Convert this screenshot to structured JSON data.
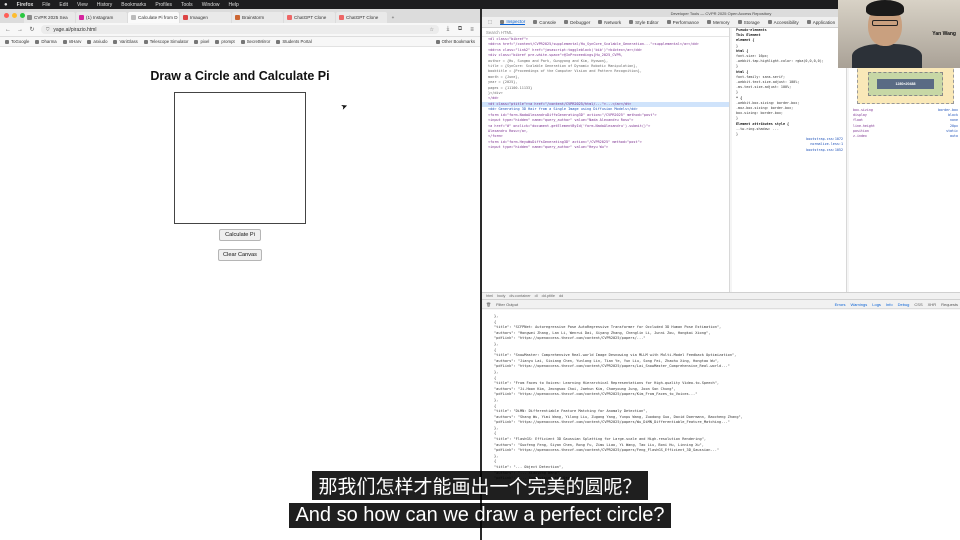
{
  "menubar": {
    "apple": "",
    "app": "Firefox",
    "items": [
      "File",
      "Edit",
      "View",
      "History",
      "Bookmarks",
      "Profiles",
      "Tools",
      "Window",
      "Help"
    ]
  },
  "browser": {
    "tabs": [
      {
        "label": "CVPR 2025 Sea"
      },
      {
        "label": "(1) Instagram"
      },
      {
        "label": "Calculate Pi from D"
      },
      {
        "label": "Imaugen"
      },
      {
        "label": "Brainstorm"
      },
      {
        "label": "ChatGPT Clone"
      },
      {
        "label": "ChatGPT Clone"
      }
    ],
    "newtab": "+",
    "url": "yage.ai/pirazio.html",
    "bookmarks": [
      "ToGoogle",
      "Dharma",
      "ntHarv",
      "arxiudo",
      "VariGlass",
      "Telescope Simulator",
      "pixel",
      "prompt",
      "SecretMirror",
      "Students Portal"
    ],
    "other_bookmarks": "Other Bookmarks"
  },
  "page": {
    "title": "Draw a Circle and Calculate Pi",
    "calc_button": "Calculate Pi",
    "clear_button": "Clear Canvas"
  },
  "devtools": {
    "window_title": "Developer Tools — CVPR 2025 Open Access Repository",
    "tabs": [
      "Inspector",
      "Console",
      "Debugger",
      "Network",
      "Style Editor",
      "Performance",
      "Memory",
      "Storage",
      "Accessibility",
      "Application"
    ],
    "search_placeholder": "Search HTML",
    "html_lines": [
      "<dl class=\"bibref\">",
      "<dd><a href=\"/content/CVPR2025/supplemental/Hu_SynCore_Scalable_Generation...\">supplemental</a></dd>",
      "<dd><a class=\"link2\" href=\"javascript:toggleblock('bib')\">bibtex</a></dd>",
      "<div class=\"bibref pre-white-space\">@InProceedings{Hu_2025_CVPR,",
      "  author    = {Hu, Sungmo and Park, Gungyong and Kim, Hyowon},",
      "  title     = {SynCore: Scalable Generation of Dynamic Robotic Manipulation},",
      "  booktitle = {Proceedings of the Computer Vision and Pattern Recognition},",
      "  month     = {June},",
      "  year      = {2025},",
      "  pages     = {11100-11133}",
      "}</div>",
      "</dd>",
      "<dt class=\"ptitle\"><a href=\"/content/CVPR2025/html/...\">...</a></dt>",
      "<dd> Generating 3D Hair from a Single Image using Diffusion Models</dd>",
      "<form id=\"form-NadaAlexandruDiffsGenerating3D\" action=\"/CVPR2025\" method=\"post\">",
      "<input type=\"hidden\" name=\"query_author\" value=\"Nada Alexandru Rosu\">",
      "<a href=\"#\" onclick=\"document.getElementById('form-NadaAlexandru').submit()\">",
      "Alexandru Rosu</a>,",
      "</form>",
      "<form id=\"form-HeyuWuDiffsGenerating3D\" action=\"/CVPR2025\" method=\"post\">",
      "<input type=\"hidden\" name=\"query_author\" value=\"Heyu Wu\">"
    ],
    "rules": [
      "Pseudo-elements",
      "This Element",
      "element {",
      "}",
      "html {",
      "  font-size: 16px;",
      "  -webkit-tap-highlight-color: rgba(0,0,0,0);",
      "}",
      "html {",
      "  font-family: sans-serif;",
      "  -webkit-text-size-adjust: 100%;",
      "  -ms-text-size-adjust: 100%;",
      "}",
      "* {",
      "  -webkit-box-sizing: border-box;",
      "  -moz-box-sizing: border-box;",
      "  box-sizing: border-box;",
      "}",
      "Element attributes style {",
      "  --tw-ring-shadow: ...",
      "}"
    ],
    "rule_links": [
      "bootstrap.css:1072",
      "normalize.less:1",
      "bootstrap.css:1052"
    ],
    "layout_tabs": "Layout   Computed   Changes   Compatibility   Fonts",
    "grid_note": "CSS Grid is not in use on this page",
    "box_content": "1280×20488",
    "box_label": "Box Model",
    "box_props": [
      {
        "k": "box-sizing",
        "v": "border-box"
      },
      {
        "k": "display",
        "v": "block"
      },
      {
        "k": "float",
        "v": "none"
      },
      {
        "k": "line-height",
        "v": "20px"
      },
      {
        "k": "position",
        "v": "static"
      },
      {
        "k": "z-index",
        "v": "auto"
      }
    ],
    "breadcrumb": [
      "html",
      "body",
      "div.container",
      "dl",
      "dd.ptitle",
      "dd"
    ],
    "console": {
      "filter_placeholder": "Filter Output",
      "filters": [
        "Errors",
        "Warnings",
        "Logs",
        "Info",
        "Debug",
        "CSS",
        "XHR",
        "Requests"
      ],
      "lines": [
        "},",
        "{",
        "\"title\": \"SCFPNet: Autoregressive Pose AutoRegressive Transformer for Occluded 3D Human Pose Estimation\",",
        "\"authors\": \"Hongwei Zhang, Lan Li, Wenrui Dai, Xiyang Zhang, Chenglin Li, Junni Zou, Hongkai Xiong\",",
        "\"pdfLink\": \"https://openaccess.thecvf.com/content/CVPR2025/papers/...\"",
        "},",
        "{",
        "\"title\": \"SnowMaster: Comprehensive Real-world Image Desnowing via MLLM with Multi-Model Feedback Optimization\",",
        "\"authors\": \"Jianyu Lai, Sixiang Chen, Yunlong Lin, Tian Ye, Yun Liu, Song Fei, Zhaohu Xing, Hongtao Wu\",",
        "\"pdfLink\": \"https://openaccess.thecvf.com/content/CVPR2025/papers/Lai_SnowMaster_Comprehensive_Real-world...\"",
        "},",
        "{",
        "\"title\": \"From Faces to Voices: Learning Hierarchical Representations for High-quality Video-to-Speech\",",
        "\"authors\": \"Ji-Hoon Kim, Jeongsoo Choi, Jaehun Kim, Chaeyoung Jung, Joon Son Chung\",",
        "\"pdfLink\": \"https://openaccess.thecvf.com/content/CVPR2025/papers/Kim_From_Faces_to_Voices...\"",
        "},",
        "{",
        "\"title\": \"DiMN: Differentiable Feature Matching for Anomaly Detection\",",
        "\"authors\": \"Shang Wu, Yimi Wang, Yilong Liu, Zugang Yang, Yunpu Wang, Zuodong Guo, David Doermann, Baocheng Zhang\",",
        "\"pdfLink\": \"https://openaccess.thecvf.com/content/CVPR2025/papers/Wu_DiMN_Differentiable_Feature_Matching...\"",
        "},",
        "{",
        "\"title\": \"FlashGS: Efficient 3D Gaussian Splatting for Large-scale and High-resolution Rendering\",",
        "\"authors\": \"Guofeng Feng, Siyan Chen, Rong Fu, Zimu Liao, Yi Wang, Tao Liu, Boni Hu, Linning Xu\",",
        "\"pdfLink\": \"https://openaccess.thecvf.com/content/CVPR2025/papers/Feng_FlashGS_Efficient_3D_Gaussian...\"",
        "},",
        "{",
        "\"title\": \"... Object Detection\",",
        "\"authors\": \"... Xiaoyong Wang\",",
        "\"pdfLink\": \"... Supervision_for_Drone-...\""
      ]
    }
  },
  "webcam": {
    "name": "Yan Wang"
  },
  "subtitles": {
    "zh": "那我们怎样才能画出一个完美的圆呢？",
    "en": "And so how can we draw a perfect circle?"
  }
}
